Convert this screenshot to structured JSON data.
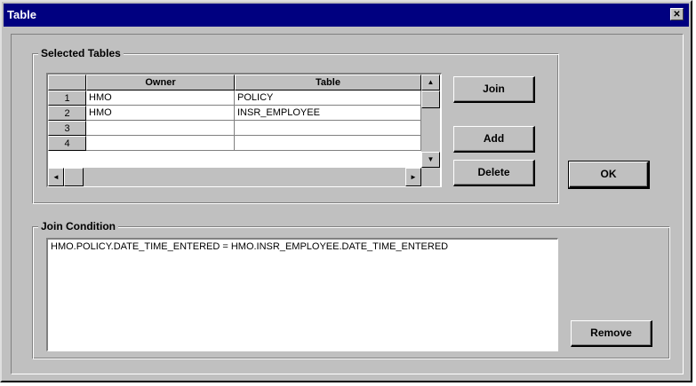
{
  "window": {
    "title": "Table",
    "close_glyph": "✕"
  },
  "selected_tables": {
    "label": "Selected Tables",
    "columns": [
      "Owner",
      "Table"
    ],
    "rows": [
      {
        "num": "1",
        "owner": "HMO",
        "table": "POLICY"
      },
      {
        "num": "2",
        "owner": "HMO",
        "table": "INSR_EMPLOYEE"
      },
      {
        "num": "3",
        "owner": "",
        "table": ""
      },
      {
        "num": "4",
        "owner": "",
        "table": ""
      }
    ]
  },
  "buttons": {
    "join": "Join",
    "add": "Add",
    "delete": "Delete",
    "ok": "OK",
    "remove": "Remove"
  },
  "join_condition": {
    "label": "Join Condition",
    "value": "HMO.POLICY.DATE_TIME_ENTERED = HMO.INSR_EMPLOYEE.DATE_TIME_ENTERED"
  },
  "scroll_glyphs": {
    "up": "▲",
    "down": "▼",
    "left": "◄",
    "right": "►"
  },
  "colors": {
    "titlebar": "#000080",
    "face": "#c0c0c0"
  }
}
